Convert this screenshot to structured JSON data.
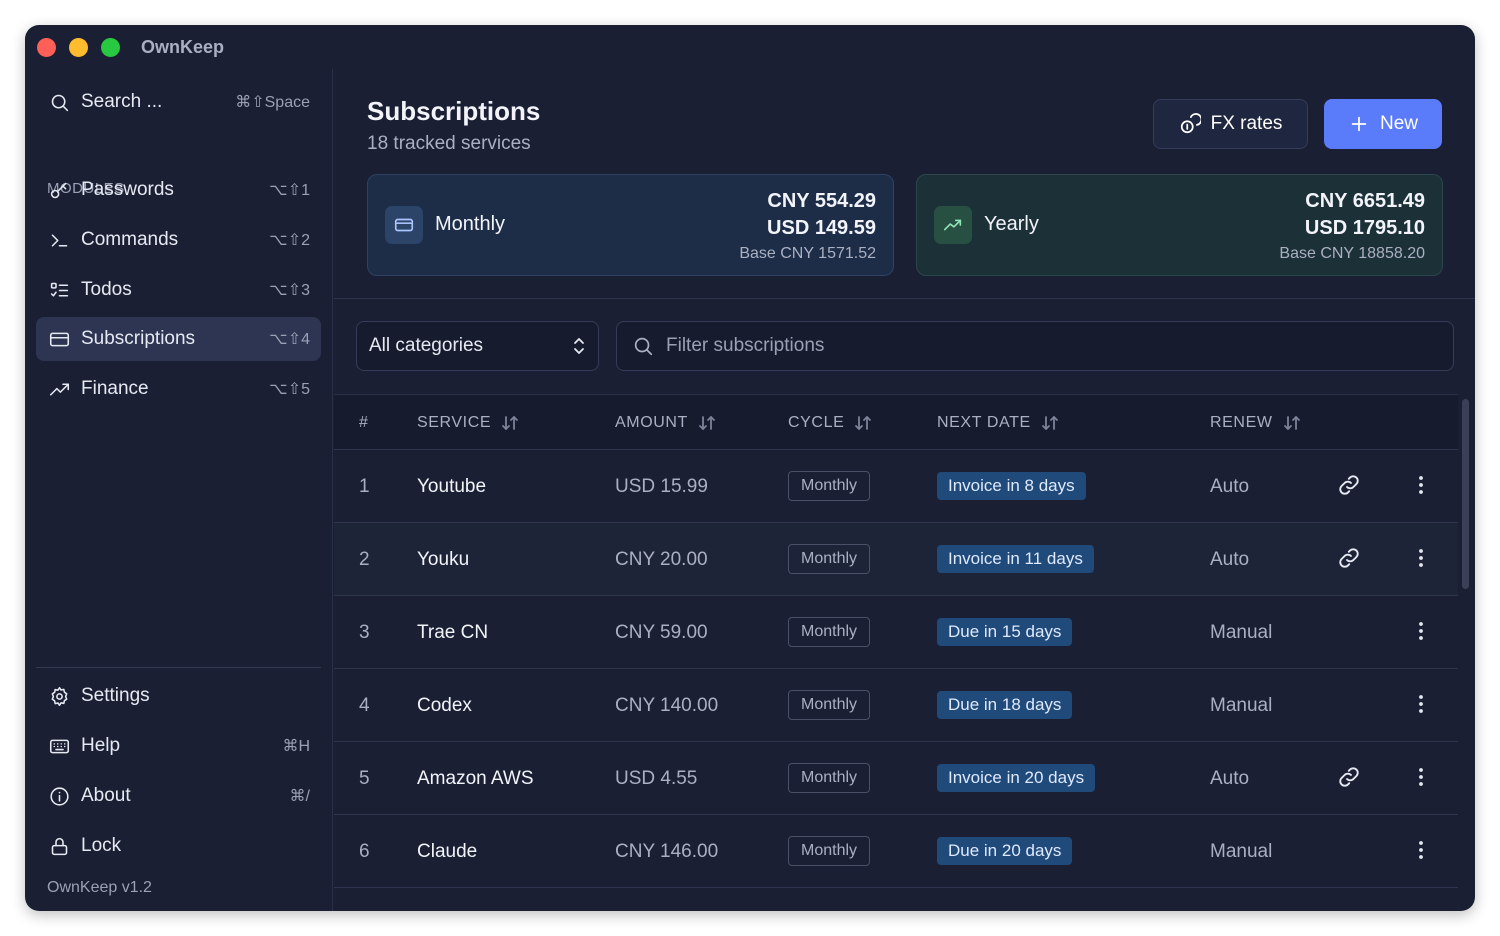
{
  "app": {
    "title": "OwnKeep",
    "version": "OwnKeep v1.2"
  },
  "sidebar": {
    "search": {
      "label": "Search ...",
      "shortcut": "⌘⇧Space",
      "icon": "search-icon"
    },
    "modules_label": "MODULES",
    "items": [
      {
        "label": "Passwords",
        "shortcut": "⌥⇧1",
        "icon": "key-icon",
        "active": false
      },
      {
        "label": "Commands",
        "shortcut": "⌥⇧2",
        "icon": "terminal-icon",
        "active": false
      },
      {
        "label": "Todos",
        "shortcut": "⌥⇧3",
        "icon": "list-todo-icon",
        "active": false
      },
      {
        "label": "Subscriptions",
        "shortcut": "⌥⇧4",
        "icon": "credit-card-icon",
        "active": true
      },
      {
        "label": "Finance",
        "shortcut": "⌥⇧5",
        "icon": "trending-up-icon",
        "active": false
      }
    ],
    "bottom": [
      {
        "label": "Settings",
        "shortcut": "",
        "icon": "gear-icon"
      },
      {
        "label": "Help",
        "shortcut": "⌘H",
        "icon": "keyboard-icon"
      },
      {
        "label": "About",
        "shortcut": "⌘/",
        "icon": "info-icon"
      },
      {
        "label": "Lock",
        "shortcut": "",
        "icon": "lock-icon"
      }
    ]
  },
  "header": {
    "title": "Subscriptions",
    "subtitle": "18 tracked services",
    "fx_label": "FX rates",
    "new_label": "New"
  },
  "summary": {
    "monthly": {
      "label": "Monthly",
      "cny": "CNY 554.29",
      "usd": "USD 149.59",
      "base": "Base CNY 1571.52"
    },
    "yearly": {
      "label": "Yearly",
      "cny": "CNY 6651.49",
      "usd": "USD 1795.10",
      "base": "Base CNY 18858.20"
    }
  },
  "filters": {
    "category": "All categories",
    "search_placeholder": "Filter subscriptions"
  },
  "table": {
    "columns": [
      "#",
      "SERVICE",
      "AMOUNT",
      "CYCLE",
      "NEXT DATE",
      "RENEW"
    ],
    "rows": [
      {
        "num": "1",
        "service": "Youtube",
        "amount": "USD 15.99",
        "cycle": "Monthly",
        "next": "Invoice in 8 days",
        "renew": "Auto",
        "link": true
      },
      {
        "num": "2",
        "service": "Youku",
        "amount": "CNY 20.00",
        "cycle": "Monthly",
        "next": "Invoice in 11 days",
        "renew": "Auto",
        "link": true
      },
      {
        "num": "3",
        "service": "Trae CN",
        "amount": "CNY 59.00",
        "cycle": "Monthly",
        "next": "Due in 15 days",
        "renew": "Manual",
        "link": false
      },
      {
        "num": "4",
        "service": "Codex",
        "amount": "CNY 140.00",
        "cycle": "Monthly",
        "next": "Due in 18 days",
        "renew": "Manual",
        "link": false
      },
      {
        "num": "5",
        "service": "Amazon AWS",
        "amount": "USD 4.55",
        "cycle": "Monthly",
        "next": "Invoice in 20 days",
        "renew": "Auto",
        "link": true
      },
      {
        "num": "6",
        "service": "Claude",
        "amount": "CNY 146.00",
        "cycle": "Monthly",
        "next": "Due in 20 days",
        "renew": "Manual",
        "link": false
      }
    ]
  },
  "colors": {
    "accent": "#5b7cfa",
    "background": "#1a1f33",
    "active_nav": "#2d3552",
    "badge": "#1f4a7a"
  }
}
